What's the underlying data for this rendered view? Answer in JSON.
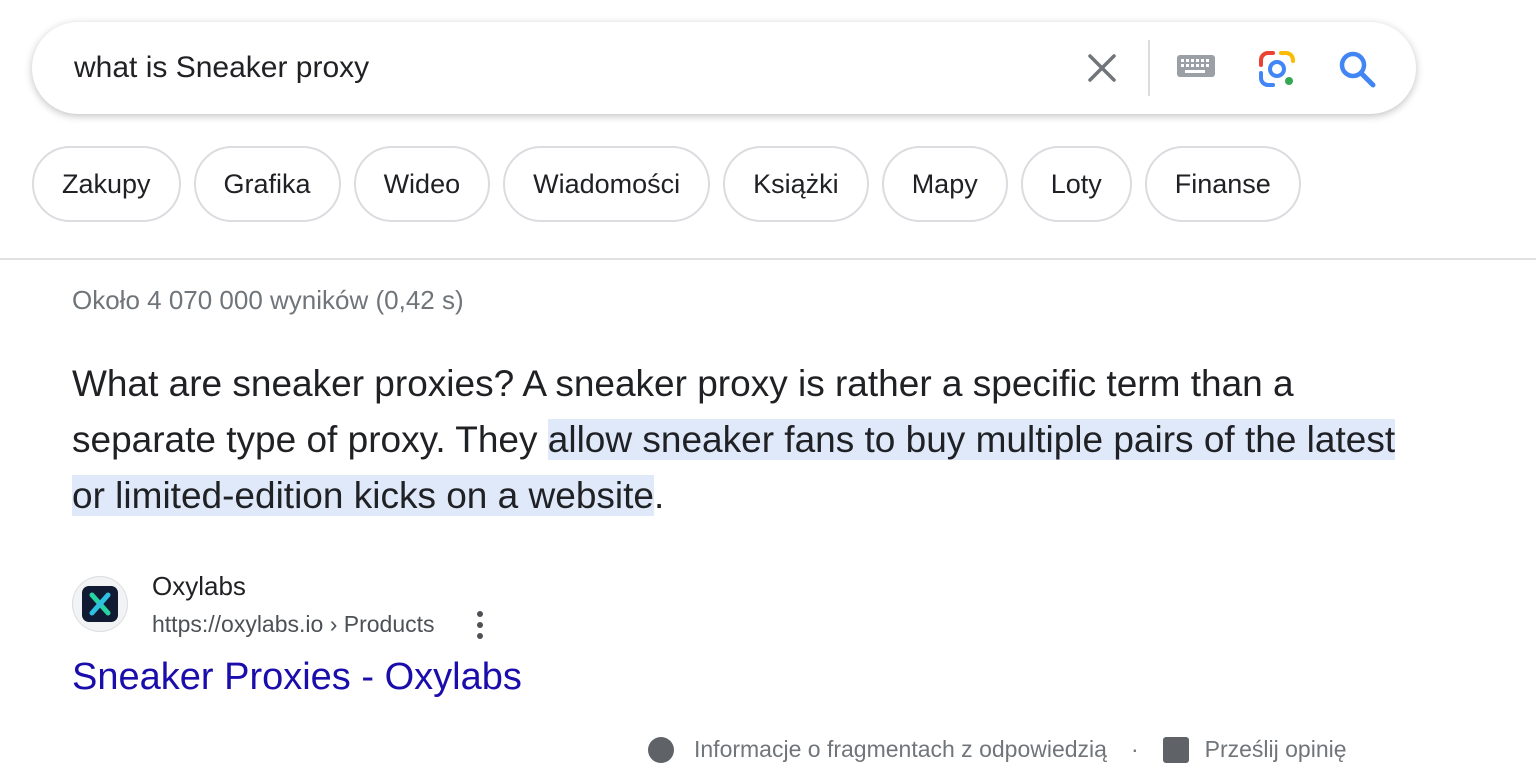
{
  "search": {
    "query": "what is Sneaker proxy"
  },
  "chips": [
    "Zakupy",
    "Grafika",
    "Wideo",
    "Wiadomości",
    "Książki",
    "Mapy",
    "Loty",
    "Finanse"
  ],
  "results_stats": "Około 4 070 000 wyników (0,42 s)",
  "featured_snippet": {
    "text_before": "What are sneaker proxies? A sneaker proxy is rather a specific term than a separate type of proxy. They ",
    "text_highlight": "allow sneaker fans to buy multiple pairs of the latest or limited-edition kicks on a website",
    "text_after": "."
  },
  "source": {
    "name": "Oxylabs",
    "url": "https://oxylabs.io › Products",
    "title": "Sneaker Proxies - Oxylabs"
  },
  "footer": {
    "about": "Informacje o fragmentach z odpowiedzią",
    "feedback": "Prześlij opinię"
  },
  "colors": {
    "link": "#1a0dab",
    "highlight": "#dfe9fa",
    "search_blue": "#4285f4"
  },
  "icons": {
    "clear": "close-icon",
    "keyboard": "keyboard-icon",
    "lens": "google-lens-icon",
    "search": "search-icon",
    "more": "more-vert-icon"
  }
}
